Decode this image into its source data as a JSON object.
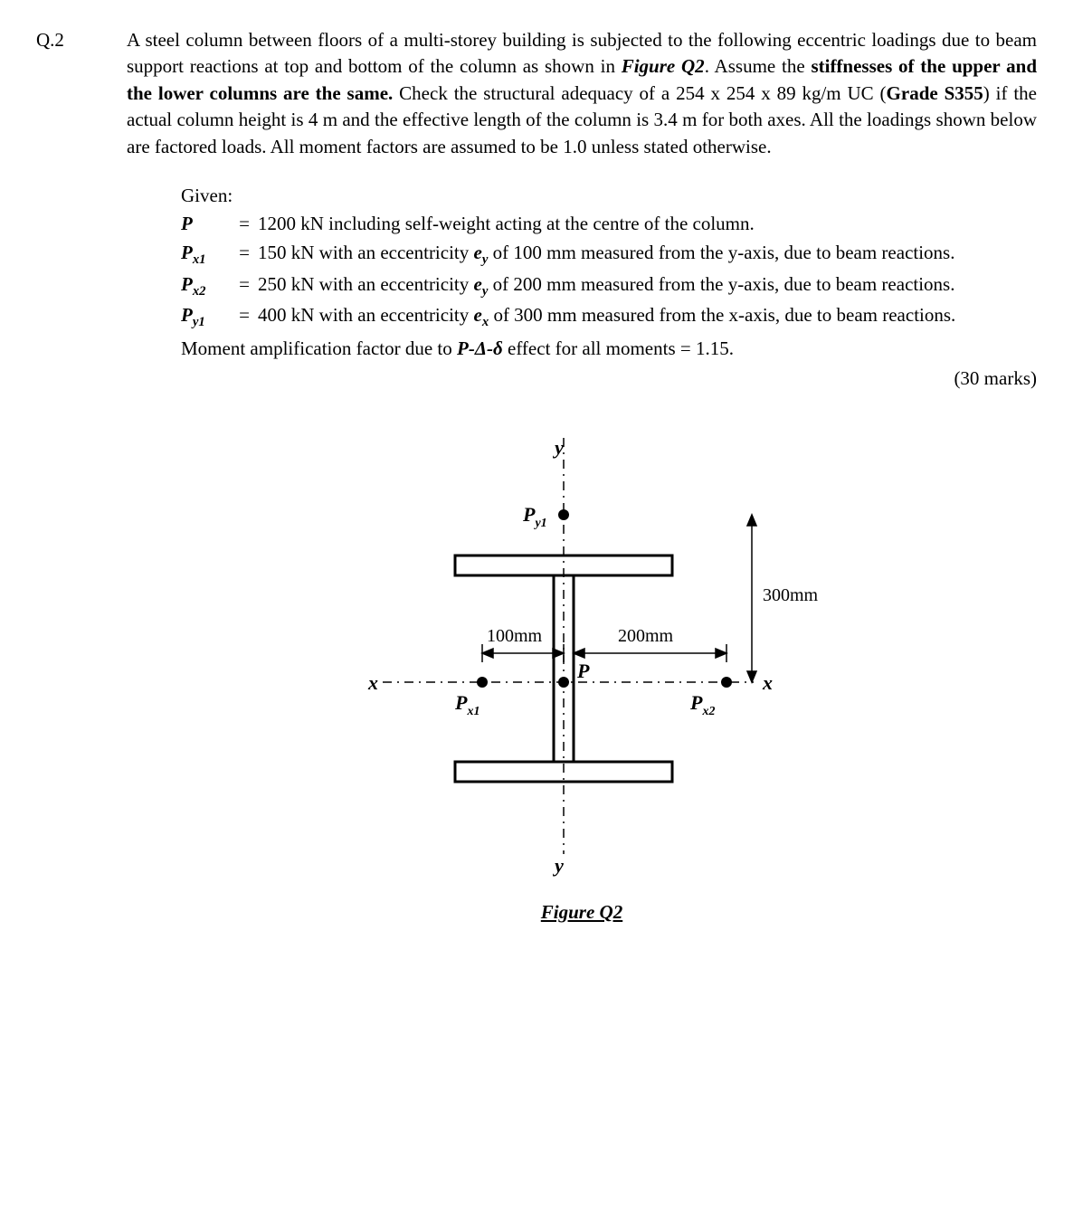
{
  "question_number": "Q.2",
  "prompt_html": "A steel column between floors of a multi-storey building is subjected to the following eccentric loadings due to beam support reactions at top and bottom of the column as shown in <span class='bi'>Figure Q2</span>. Assume the <span class='bold'>stiffnesses of the upper and the lower columns are the same.</span> Check the structural adequacy of a 254 x 254 x 89 kg/m UC (<span class='bold'>Grade S355</span>) if the actual column height is 4 m and the effective length of the column is 3.4 m for both axes. All the loadings shown below are factored loads. All moment factors are assumed to be 1.0 unless stated otherwise.",
  "given_label": "Given:",
  "given": [
    {
      "sym": "<span class='bi'>P</span>",
      "val": "1200 kN including self-weight acting at the centre of the column."
    },
    {
      "sym": "<span class='bi'>P<span class='sub'>x1</span></span>",
      "val": "150 kN with an eccentricity <span class='bi'>e<span class='sub'>y</span></span> of 100 mm measured from the y-axis, due to beam reactions."
    },
    {
      "sym": "<span class='bi'>P<span class='sub'>x2</span></span>",
      "val": "250 kN with an eccentricity <span class='bi'>e<span class='sub'>y</span></span> of 200 mm measured from the y-axis, due to beam reactions."
    },
    {
      "sym": "<span class='bi'>P<span class='sub'>y1</span></span>",
      "val": "400 kN with an eccentricity <span class='bi'>e<span class='sub'>x</span></span> of 300 mm measured from the x-axis, due to beam reactions."
    }
  ],
  "amp_line": "Moment amplification factor due to <span class='bi'>P-Δ-δ</span>  effect for all moments = 1.15.",
  "marks": "(30 marks)",
  "figure": {
    "caption": "Figure Q2",
    "labels": {
      "y_top": "y",
      "y_bot": "y",
      "x_left": "x",
      "x_right": "x",
      "Py1": "P",
      "Py1_sub": "y1",
      "Px1": "P",
      "Px1_sub": "x1",
      "Px2": "P",
      "Px2_sub": "x2",
      "P": "P",
      "d100": "100mm",
      "d200": "200mm",
      "d300": "300mm"
    }
  }
}
